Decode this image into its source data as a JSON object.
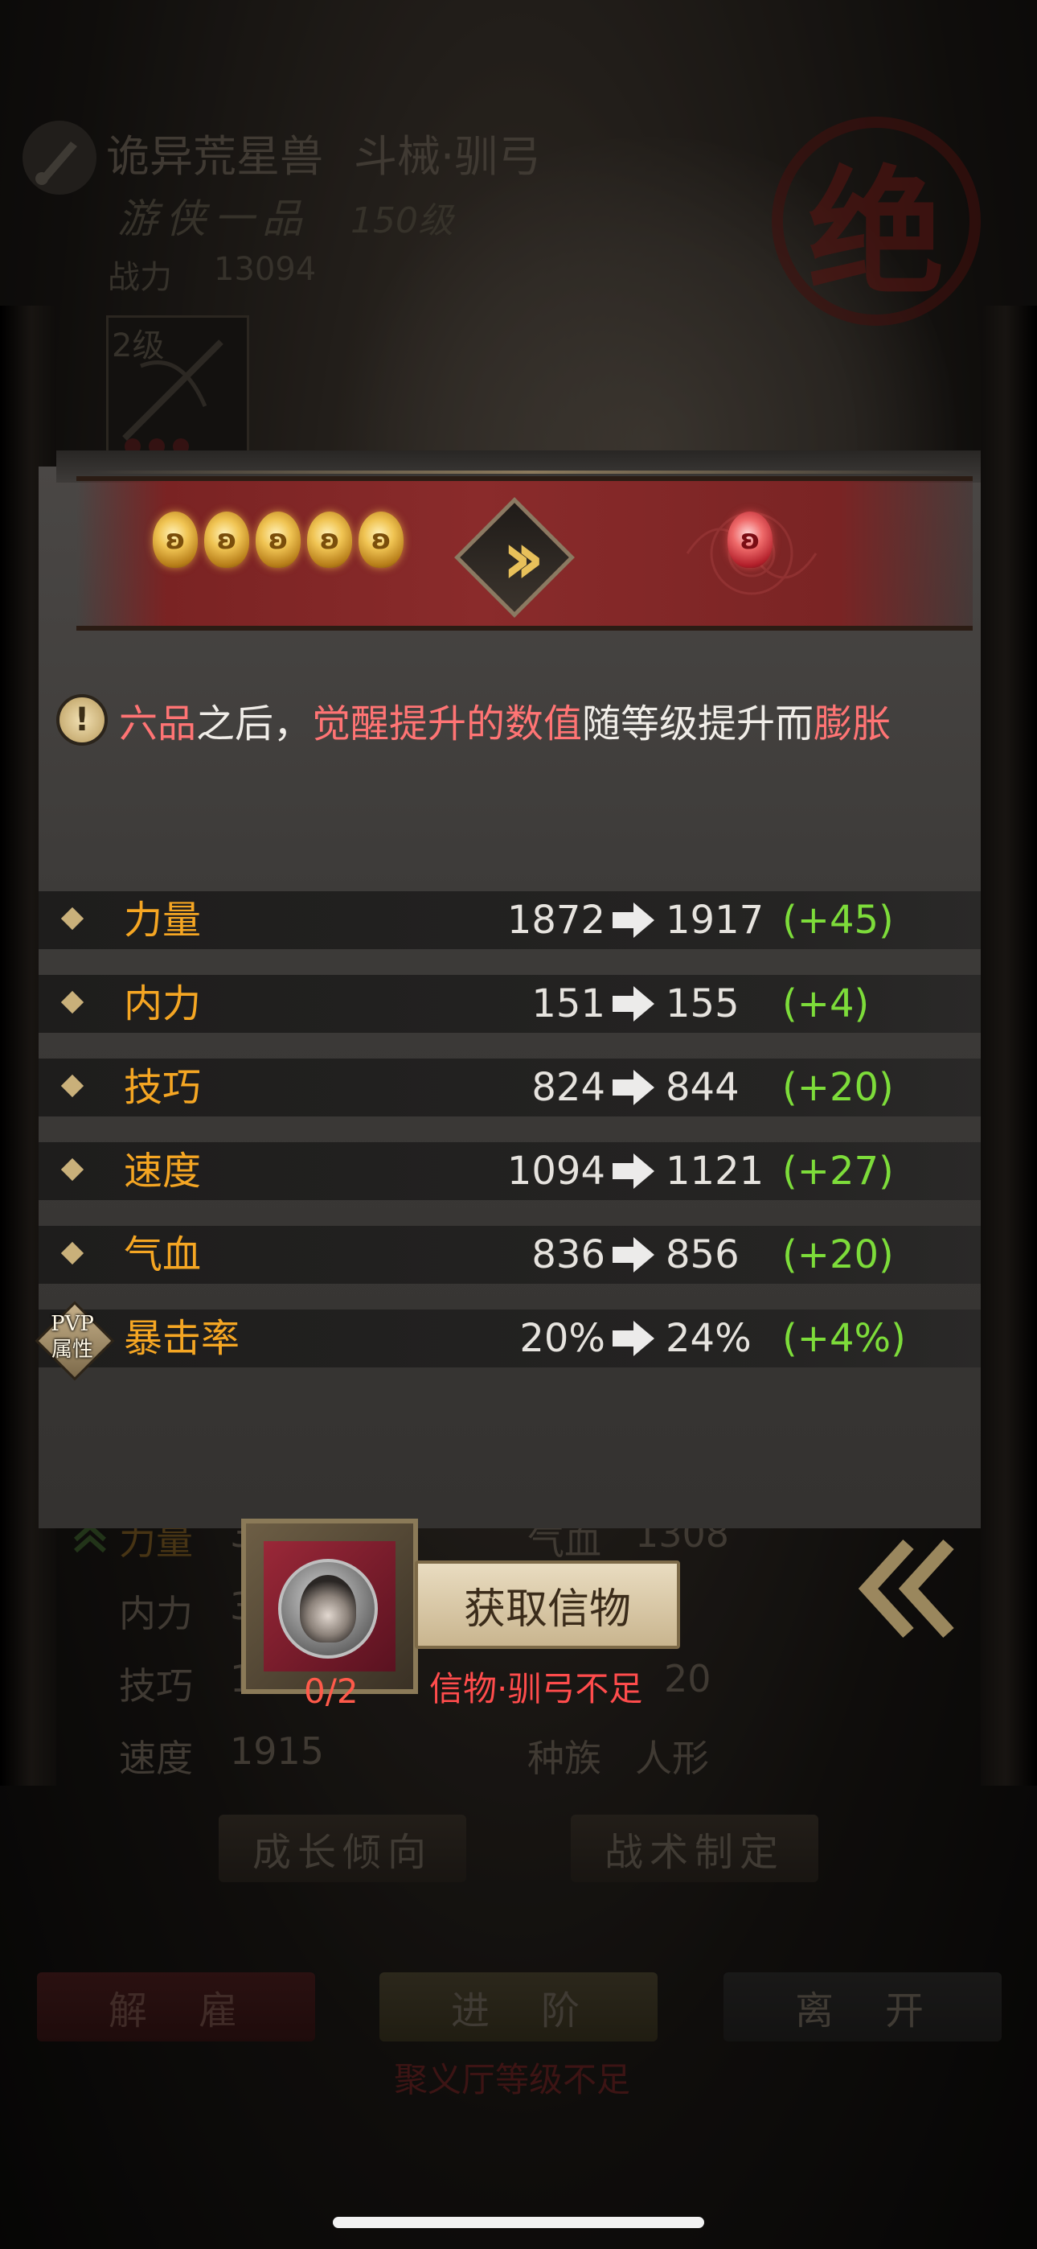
{
  "background": {
    "unit_name": "诡异荒星兽",
    "weapon_name": "斗械·驯弓",
    "rank": "游侠一品",
    "level": "150级",
    "power_label": "战力",
    "power_value": "13094",
    "item_level": "2级",
    "seal_char": "绝",
    "stats": [
      {
        "label": "力量",
        "value": "3"
      },
      {
        "label": "气血",
        "value": "1308"
      },
      {
        "label": "内力",
        "value": "3"
      },
      {
        "label": "技巧",
        "value": "1"
      },
      {
        "label": "速度",
        "value": "1915"
      },
      {
        "label": "种族",
        "value": "人形"
      },
      {
        "label": "内力",
        "value": "20"
      }
    ],
    "buttons": {
      "growth": "成长倾向",
      "tactics": "战术制定",
      "dismiss": "解　雇",
      "advance": "进　阶",
      "leave": "离　开"
    },
    "warning": "聚义厅等级不足"
  },
  "popup": {
    "orbs_before": 5,
    "orbs_after": 1,
    "notice": {
      "p1": "六品",
      "p2": "之后，",
      "p3": "觉醒提升的数值",
      "p4": "随等级提升而",
      "p5": "膨胀"
    },
    "stats": [
      {
        "name": "力量",
        "old": "1872",
        "new": "1917",
        "delta": "(+45)"
      },
      {
        "name": "内力",
        "old": "151",
        "new": "155",
        "delta": "(+4)"
      },
      {
        "name": "技巧",
        "old": "824",
        "new": "844",
        "delta": "(+20)"
      },
      {
        "name": "速度",
        "old": "1094",
        "new": "1121",
        "delta": "(+27)"
      },
      {
        "name": "气血",
        "old": "836",
        "new": "856",
        "delta": "(+20)"
      },
      {
        "name": "暴击率",
        "old": "20%",
        "new": "24%",
        "delta": "(+4%)"
      }
    ],
    "pvp_badge": {
      "line1": "PVP",
      "line2": "属性"
    },
    "item_count": "0/2",
    "get_button": "获取信物",
    "lack_text": "信物·驯弓不足"
  },
  "colors": {
    "stat_name": "#f5a623",
    "delta": "#7ddc3a",
    "highlight": "#ff7474",
    "banner": "#8a2b2b"
  }
}
